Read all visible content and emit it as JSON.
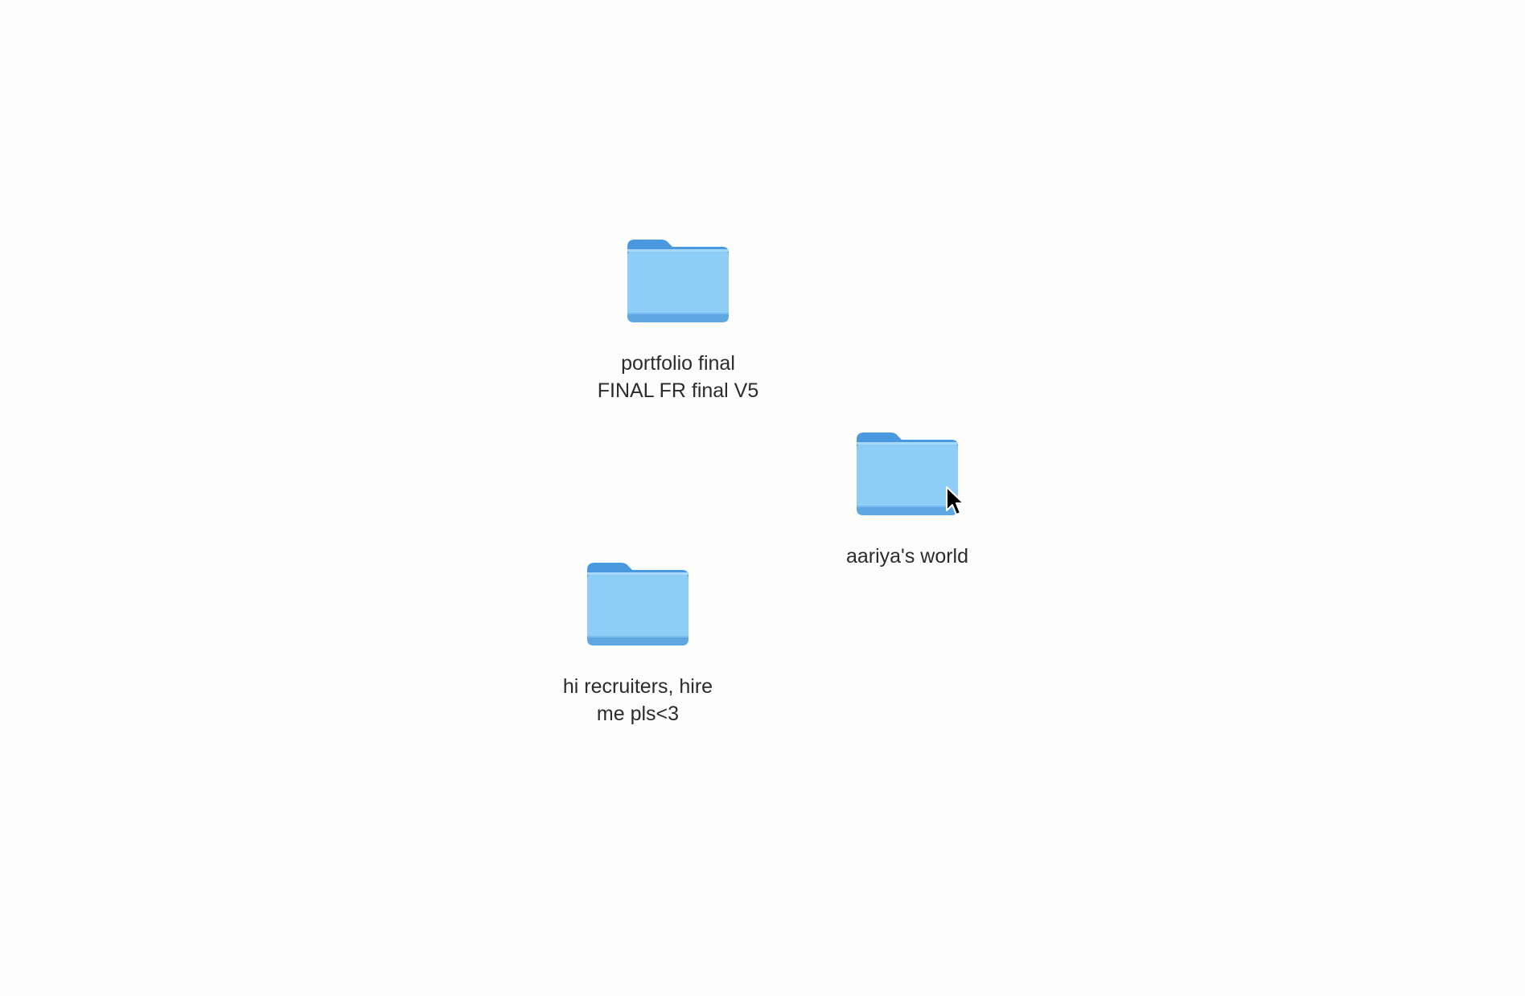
{
  "desktop": {
    "background": "#fdfdfd",
    "items": [
      {
        "label": "portfolio final\nFINAL FR final V5",
        "icon": "folder-icon"
      },
      {
        "label": "aariya's world",
        "icon": "folder-icon"
      },
      {
        "label": "hi recruiters, hire\nme pls<3",
        "icon": "folder-icon"
      }
    ]
  },
  "colors": {
    "folder_body": "#8dcdf6",
    "folder_back": "#4a98dd",
    "folder_bottom": "#5ea7e3",
    "label_text": "#2b2b2b"
  },
  "cursor": {
    "icon": "arrow-cursor-icon"
  }
}
